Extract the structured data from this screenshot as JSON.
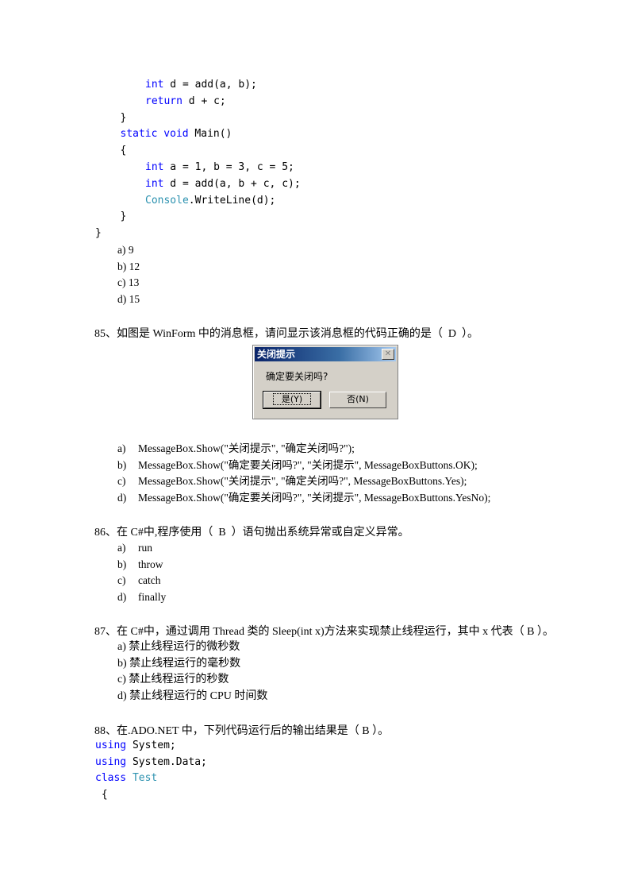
{
  "code_top": [
    {
      "indent": 2,
      "tokens": [
        {
          "t": "int",
          "c": "kw"
        },
        {
          "t": " d = add(a, b);",
          "c": ""
        }
      ]
    },
    {
      "indent": 2,
      "tokens": [
        {
          "t": "return",
          "c": "kw"
        },
        {
          "t": " d + c;",
          "c": ""
        }
      ]
    },
    {
      "indent": 1,
      "tokens": [
        {
          "t": "}",
          "c": ""
        }
      ]
    },
    {
      "indent": 1,
      "tokens": [
        {
          "t": "static void",
          "c": "kw"
        },
        {
          "t": " Main()",
          "c": ""
        }
      ]
    },
    {
      "indent": 1,
      "tokens": [
        {
          "t": "{",
          "c": ""
        }
      ]
    },
    {
      "indent": 2,
      "tokens": [
        {
          "t": "int",
          "c": "kw"
        },
        {
          "t": " a = 1, b = 3, c = 5;",
          "c": ""
        }
      ]
    },
    {
      "indent": 2,
      "tokens": [
        {
          "t": "int",
          "c": "kw"
        },
        {
          "t": " d = add(a, b + c, c);",
          "c": ""
        }
      ]
    },
    {
      "indent": 2,
      "tokens": [
        {
          "t": "Console",
          "c": "ty"
        },
        {
          "t": ".WriteLine(d);",
          "c": ""
        }
      ]
    },
    {
      "indent": 1,
      "tokens": [
        {
          "t": "}",
          "c": ""
        }
      ]
    },
    {
      "indent": 0,
      "tokens": [
        {
          "t": "}",
          "c": ""
        }
      ]
    }
  ],
  "q84_options": [
    "a) 9",
    "b) 12",
    "c) 13",
    "d) 15"
  ],
  "q85": {
    "stem": "85、如图是 WinForm 中的消息框，请问显示该消息框的代码正确的是（  D  ）。",
    "dialog": {
      "title": "关闭提示",
      "close": "✕",
      "message": "确定要关闭吗?",
      "yes": "是(Y)",
      "no": "否(N)"
    },
    "options": [
      {
        "label": "a)",
        "text": "MessageBox.Show(\"关闭提示\", \"确定关闭吗?\");"
      },
      {
        "label": "b)",
        "text": "MessageBox.Show(\"确定要关闭吗?\", \"关闭提示\", MessageBoxButtons.OK);"
      },
      {
        "label": "c)",
        "text": "MessageBox.Show(\"关闭提示\", \"确定关闭吗?\", MessageBoxButtons.Yes);"
      },
      {
        "label": "d)",
        "text": "MessageBox.Show(\"确定要关闭吗?\", \"关闭提示\", MessageBoxButtons.YesNo);"
      }
    ]
  },
  "q86": {
    "stem": "86、在 C#中,程序使用（  B  ）语句抛出系统异常或自定义异常。",
    "options": [
      {
        "label": "a)",
        "text": "run"
      },
      {
        "label": "b)",
        "text": "throw"
      },
      {
        "label": "c)",
        "text": "catch"
      },
      {
        "label": "d)",
        "text": "finally"
      }
    ]
  },
  "q87": {
    "stem": "87、在 C#中，通过调用 Thread 类的 Sleep(int x)方法来实现禁止线程运行，其中 x 代表（ B ）。",
    "options": [
      "a) 禁止线程运行的微秒数",
      "b) 禁止线程运行的毫秒数",
      "c) 禁止线程运行的秒数",
      "d) 禁止线程运行的 CPU 时间数"
    ]
  },
  "q88": {
    "stem": "88、在.ADO.NET 中，下列代码运行后的输出结果是（ B ）。",
    "code": [
      {
        "tokens": [
          {
            "t": "using",
            "c": "kw"
          },
          {
            "t": " System;",
            "c": ""
          }
        ]
      },
      {
        "tokens": [
          {
            "t": "using",
            "c": "kw"
          },
          {
            "t": " System.Data;",
            "c": ""
          }
        ]
      },
      {
        "tokens": [
          {
            "t": "class",
            "c": "kw"
          },
          {
            "t": " Test",
            "c": "ty"
          }
        ]
      },
      {
        "tokens": [
          {
            "t": " {",
            "c": ""
          }
        ]
      }
    ]
  }
}
